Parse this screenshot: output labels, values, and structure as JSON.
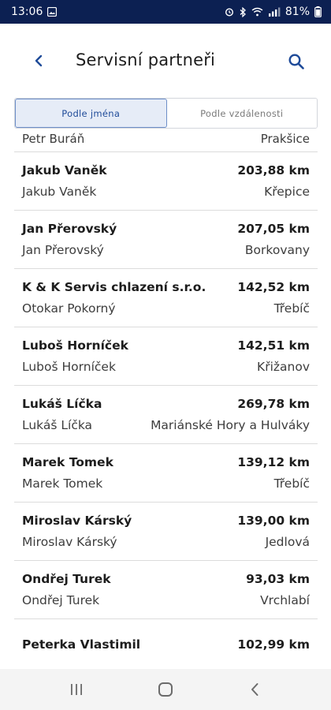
{
  "status": {
    "time": "13:06",
    "battery": "81%"
  },
  "header": {
    "title": "Servisní partneři"
  },
  "tabs": [
    {
      "label": "Podle jména",
      "active": true
    },
    {
      "label": "Podle vzdálenosti",
      "active": false
    }
  ],
  "partial_row": {
    "contact": "Petr Buráň",
    "city": "Prakšice"
  },
  "partners": [
    {
      "name": "Jakub Vaněk",
      "distance": "203,88 km",
      "contact": "Jakub Vaněk",
      "city": "Křepice"
    },
    {
      "name": "Jan Přerovský",
      "distance": "207,05 km",
      "contact": "Jan Přerovský",
      "city": "Borkovany"
    },
    {
      "name": "K & K Servis chlazení s.r.o.",
      "distance": "142,52 km",
      "contact": "Otokar Pokorný",
      "city": "Třebíč"
    },
    {
      "name": "Luboš Horníček",
      "distance": "142,51 km",
      "contact": "Luboš Horníček",
      "city": "Křižanov"
    },
    {
      "name": "Lukáš Líčka",
      "distance": "269,78 km",
      "contact": "Lukáš Líčka",
      "city": "Mariánské Hory a Hulváky"
    },
    {
      "name": "Marek Tomek",
      "distance": "139,12 km",
      "contact": "Marek Tomek",
      "city": "Třebíč"
    },
    {
      "name": "Miroslav Kárský",
      "distance": "139,00 km",
      "contact": "Miroslav Kárský",
      "city": "Jedlová"
    },
    {
      "name": "Ondřej Turek",
      "distance": "93,03 km",
      "contact": "Ondřej Turek",
      "city": "Vrchlabí"
    },
    {
      "name": "Peterka Vlastimil",
      "distance": "102,99 km",
      "contact": "",
      "city": ""
    }
  ],
  "icons": {
    "back": "chevron-left-icon",
    "search": "search-icon",
    "nav_recents": "recents-icon",
    "nav_home": "home-icon",
    "nav_back": "back-icon"
  },
  "colors": {
    "status_bar": "#0c2052",
    "accent": "#1f4b99",
    "tab_active_bg": "#e6ecf7"
  }
}
